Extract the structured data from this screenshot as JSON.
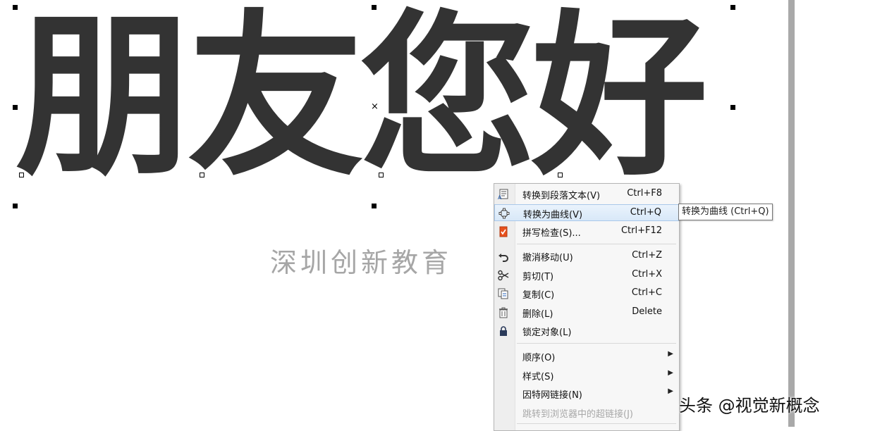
{
  "canvas": {
    "headline": "朋友您好",
    "subtitle": "深圳创新教育"
  },
  "context_menu": {
    "items": [
      {
        "label": "转换到段落文本(V)",
        "shortcut": "Ctrl+F8",
        "icon": "paragraph-text-icon"
      },
      {
        "label": "转换为曲线(V)",
        "shortcut": "Ctrl+Q",
        "icon": "convert-curve-icon"
      },
      {
        "label": "拼写检查(S)...",
        "shortcut": "Ctrl+F12",
        "icon": "spellcheck-icon"
      },
      {
        "label": "撤消移动(U)",
        "shortcut": "Ctrl+Z",
        "icon": "undo-icon"
      },
      {
        "label": "剪切(T)",
        "shortcut": "Ctrl+X",
        "icon": "scissors-icon"
      },
      {
        "label": "复制(C)",
        "shortcut": "Ctrl+C",
        "icon": "copy-icon"
      },
      {
        "label": "删除(L)",
        "shortcut": "Delete",
        "icon": "trash-icon"
      },
      {
        "label": "锁定对象(L)",
        "shortcut": "",
        "icon": "lock-icon"
      },
      {
        "label": "顺序(O)",
        "shortcut": "",
        "icon": ""
      },
      {
        "label": "样式(S)",
        "shortcut": "",
        "icon": ""
      },
      {
        "label": "因特网链接(N)",
        "shortcut": "",
        "icon": ""
      },
      {
        "label": "跳转到浏览器中的超链接(J)",
        "shortcut": "",
        "icon": ""
      }
    ]
  },
  "tooltip": {
    "text": "转换为曲线 (Ctrl+Q)"
  },
  "watermark": {
    "text": "头条 @视觉新概念"
  },
  "colors": {
    "headline": "#333333",
    "subtitle": "#a6a6a6",
    "highlight": "#d8e8f8",
    "scrollbar": "#a9a9a9"
  }
}
